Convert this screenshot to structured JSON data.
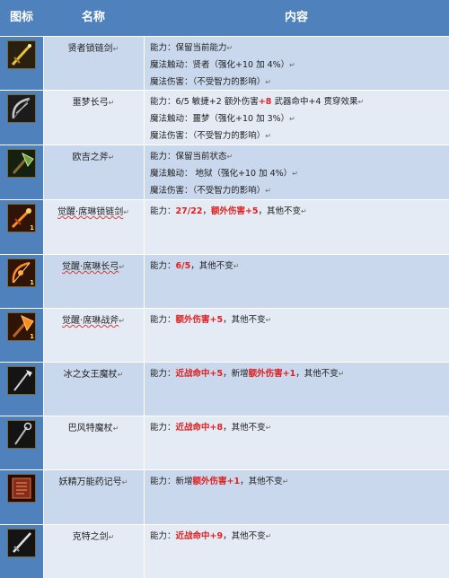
{
  "header": {
    "icon": "图标",
    "name": "名称",
    "content": "内容"
  },
  "colors": {
    "header_bg": "#4f81bd",
    "row_odd": "#c9d8ec",
    "row_even": "#e4ebf5",
    "highlight": "#e02020"
  },
  "return_mark": "↵",
  "rows": [
    {
      "icon": "golden-chain-sword-icon",
      "name": "贤者锁链剑",
      "lines": [
        [
          {
            "t": "能力：保留当前能力"
          }
        ],
        [
          {
            "t": "魔法触动：贤者（强化+10 加 4%）"
          }
        ],
        [
          {
            "t": "魔法伤害：（不受智力的影响）"
          }
        ]
      ]
    },
    {
      "icon": "dream-longbow-icon",
      "name": "噩梦长弓",
      "lines": [
        [
          {
            "t": "能力：6/5 敏捷+2 额外伤害"
          },
          {
            "t": "+8",
            "hl": true
          },
          {
            "t": " 武器命中+4 贯穿效果"
          }
        ],
        [
          {
            "t": "魔法触动：噩梦（强化+10 加 3%）"
          }
        ],
        [
          {
            "t": "魔法伤害：（不受智力的影响）"
          }
        ]
      ]
    },
    {
      "icon": "ogre-axe-icon",
      "name": "欧吉之斧",
      "lines": [
        [
          {
            "t": "能力：保留当前状态"
          }
        ],
        [
          {
            "t": "魔法触动： 地狱（强化+10 加 4%）"
          }
        ],
        [
          {
            "t": "魔法伤害：（不受智力的影响）"
          }
        ]
      ]
    },
    {
      "icon": "awakened-chain-sword-icon",
      "name": "觉醒·席琳锁链剑",
      "badge": "1",
      "lines": [
        [
          {
            "t": "能力："
          },
          {
            "t": "27/22",
            "hl": true
          },
          {
            "t": "，"
          },
          {
            "t": "额外伤害+5",
            "hl": true
          },
          {
            "t": "，其他不变"
          }
        ]
      ]
    },
    {
      "icon": "awakened-longbow-icon",
      "name": "觉醒·席琳长弓",
      "badge": "1",
      "lines": [
        [
          {
            "t": "能力："
          },
          {
            "t": "6/5",
            "hl": true
          },
          {
            "t": "，其他不变"
          }
        ]
      ]
    },
    {
      "icon": "awakened-battle-axe-icon",
      "name": "觉醒·席琳战斧",
      "badge": "1",
      "lines": [
        [
          {
            "t": "能力："
          },
          {
            "t": "额外伤害+5",
            "hl": true
          },
          {
            "t": "，其他不变"
          }
        ]
      ]
    },
    {
      "icon": "ice-queen-staff-icon",
      "name": "冰之女王魔杖",
      "lines": [
        [
          {
            "t": "能力："
          },
          {
            "t": "近战命中+5",
            "hl": true
          },
          {
            "t": "，新增"
          },
          {
            "t": "额外伤害+1",
            "hl": true
          },
          {
            "t": "，其他不变"
          }
        ]
      ]
    },
    {
      "icon": "baphomet-staff-icon",
      "name": "巴风特魔杖",
      "lines": [
        [
          {
            "t": "能力："
          },
          {
            "t": "近战命中+8",
            "hl": true
          },
          {
            "t": "，其他不变"
          }
        ]
      ]
    },
    {
      "icon": "elf-spellbook-icon",
      "name": "妖精万能药记号",
      "lines": [
        [
          {
            "t": "能力：新增"
          },
          {
            "t": "额外伤害+1",
            "hl": true
          },
          {
            "t": "，其他不变"
          }
        ]
      ]
    },
    {
      "icon": "kurt-sword-icon",
      "name": "克特之剑",
      "lines": [
        [
          {
            "t": "能力："
          },
          {
            "t": "近战命中+9",
            "hl": true
          },
          {
            "t": "，其他不变"
          }
        ]
      ]
    }
  ]
}
